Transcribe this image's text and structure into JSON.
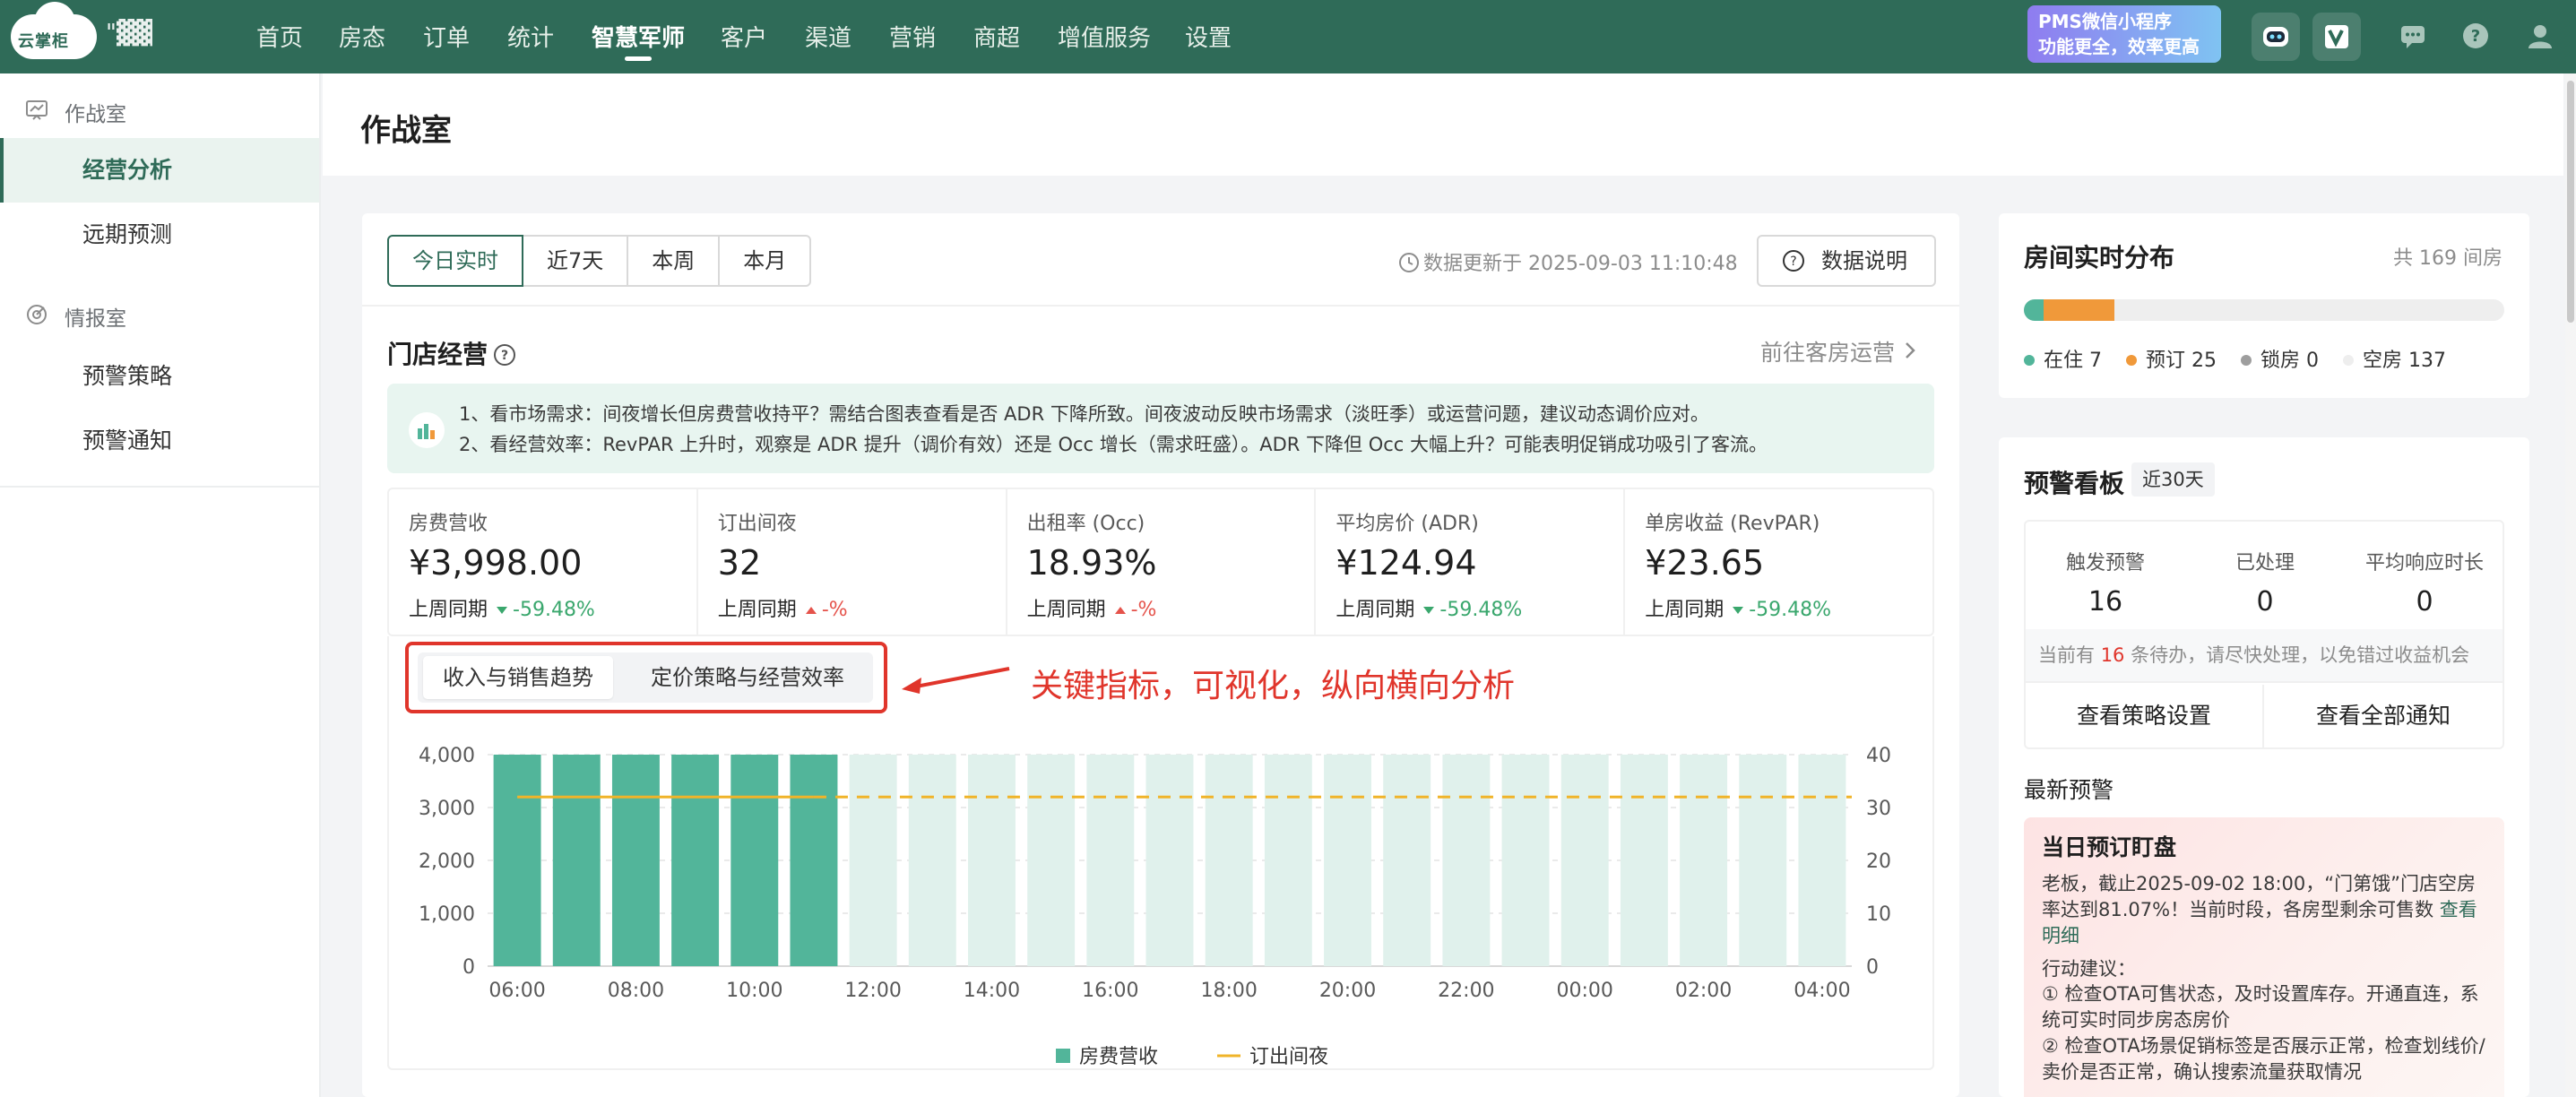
{
  "app": {
    "logo_text": "云掌柜",
    "hotel_name": "\"▓▓"
  },
  "nav": {
    "items": [
      "首页",
      "房态",
      "订单",
      "统计",
      "智慧军师",
      "客户",
      "渠道",
      "营销",
      "商超",
      "增值服务",
      "设置"
    ],
    "active": "智慧军师",
    "promo_line1": "PMS微信小程序",
    "promo_line2": "功能更全，效率更高"
  },
  "sidebar": {
    "group1": "作战室",
    "group1_items": [
      "经营分析",
      "远期预测"
    ],
    "group2": "情报室",
    "group2_items": [
      "预警策略",
      "预警通知"
    ],
    "active_item": "经营分析"
  },
  "page": {
    "title": "作战室"
  },
  "main": {
    "tabs": [
      "今日实时",
      "近7天",
      "本周",
      "本月"
    ],
    "active_tab": "今日实时",
    "updated_text": "数据更新于 2025-09-03 11:10:48",
    "explain_button": "数据说明",
    "section_title": "门店经营",
    "goto_link": "前往客房运营",
    "tips": [
      "1、看市场需求：间夜增长但房费营收持平？需结合图表查看是否 ADR 下降所致。间夜波动反映市场需求（淡旺季）或运营问题，建议动态调价应对。",
      "2、看经营效率：RevPAR 上升时，观察是 ADR 提升（调价有效）还是 Occ 增长（需求旺盛）。ADR 下降但 Occ 大幅上升？可能表明促销成功吸引了客流。"
    ],
    "kpis": [
      {
        "label": "房费营收",
        "value": "¥3,998.00",
        "compare_label": "上周同期",
        "change": "-59.48%",
        "direction": "down"
      },
      {
        "label": "订出间夜",
        "value": "32",
        "compare_label": "上周同期",
        "change": "-%",
        "direction": "up"
      },
      {
        "label": "出租率 (Occ)",
        "value": "18.93%",
        "compare_label": "上周同期",
        "change": "-%",
        "direction": "up"
      },
      {
        "label": "平均房价 (ADR)",
        "value": "¥124.94",
        "compare_label": "上周同期",
        "change": "-59.48%",
        "direction": "down"
      },
      {
        "label": "单房收益 (RevPAR)",
        "value": "¥23.65",
        "compare_label": "上周同期",
        "change": "-59.48%",
        "direction": "down"
      }
    ],
    "subtabs": [
      "收入与销售趋势",
      "定价策略与经营效率"
    ],
    "active_subtab": "收入与销售趋势",
    "annotation": "关键指标，可视化，纵向横向分析"
  },
  "chart_data": {
    "type": "bar",
    "categories": [
      "06:00",
      "07:00",
      "08:00",
      "09:00",
      "10:00",
      "11:00",
      "12:00",
      "13:00",
      "14:00",
      "15:00",
      "16:00",
      "17:00",
      "18:00",
      "19:00",
      "20:00",
      "21:00",
      "22:00",
      "23:00",
      "00:00",
      "01:00",
      "02:00",
      "03:00",
      "04:00"
    ],
    "tick_labels": [
      "06:00",
      "08:00",
      "10:00",
      "12:00",
      "14:00",
      "16:00",
      "18:00",
      "20:00",
      "22:00",
      "00:00",
      "02:00",
      "04:00"
    ],
    "series": [
      {
        "name": "房费营收",
        "type": "bar",
        "axis": "left",
        "values": [
          4000,
          4000,
          4000,
          4000,
          4000,
          4000,
          null,
          null,
          null,
          null,
          null,
          null,
          null,
          null,
          null,
          null,
          null,
          null,
          null,
          null,
          null,
          null,
          null
        ],
        "future_values": [
          4000,
          4000,
          4000,
          4000,
          4000,
          4000,
          4000,
          4000,
          4000,
          4000,
          4000,
          4000,
          4000,
          4000,
          4000,
          4000,
          4000,
          4000,
          4000,
          4000,
          4000,
          4000,
          4000
        ],
        "color": "#52b59a",
        "future_color": "#e0f1ec"
      },
      {
        "name": "订出间夜",
        "type": "line",
        "axis": "right",
        "value": 32,
        "solid_until_index": 5,
        "color": "#f0b429"
      }
    ],
    "y_left": {
      "ticks": [
        "0",
        "1,000",
        "2,000",
        "3,000",
        "4,000"
      ],
      "range": [
        0,
        4000
      ]
    },
    "y_right": {
      "ticks": [
        "0",
        "10",
        "20",
        "30",
        "40"
      ],
      "range": [
        0,
        40
      ]
    },
    "grid": true,
    "legend_position": "bottom"
  },
  "rooms": {
    "title": "房间实时分布",
    "total": "共 169 间房",
    "segments": [
      {
        "label": "在住 7",
        "count": 7,
        "color": "#52b59a"
      },
      {
        "label": "预订 25",
        "count": 25,
        "color": "#f0993a"
      },
      {
        "label": "锁房 0",
        "count": 0,
        "color": "#9e9e9e"
      },
      {
        "label": "空房 137",
        "count": 137,
        "color": "#eeeeee"
      }
    ]
  },
  "warnings": {
    "title": "预警看板",
    "period": "近30天",
    "stats": [
      {
        "label": "触发预警",
        "value": "16"
      },
      {
        "label": "已处理",
        "value": "0"
      },
      {
        "label": "平均响应时长",
        "value": "0"
      }
    ],
    "note_prefix": "当前有",
    "note_count": "16",
    "note_suffix": "条待办，请尽快处理，以免错过收益机会",
    "btn_policy": "查看策略设置",
    "btn_all": "查看全部通知",
    "latest_title": "最新预警",
    "alert_title": "当日预订盯盘",
    "alert_text": "老板，截止2025-09-02 18:00，“门第饿”门店空房率达到81.07%！当前时段，各房型剩余可售数",
    "alert_link": "查看明细",
    "alert_actions_title": "行动建议：",
    "alert_action1": "① 检查OTA可售状态，及时设置库存。开通直连，系统可实时同步房态房价",
    "alert_action2": "② 检查OTA场景促销标签是否展示正常，检查划线价/卖价是否正常，确认搜索流量获取情况"
  },
  "colors": {
    "brand": "#2f6b58",
    "accent_red": "#e0352b",
    "bar": "#52b59a",
    "line": "#f0b429"
  }
}
